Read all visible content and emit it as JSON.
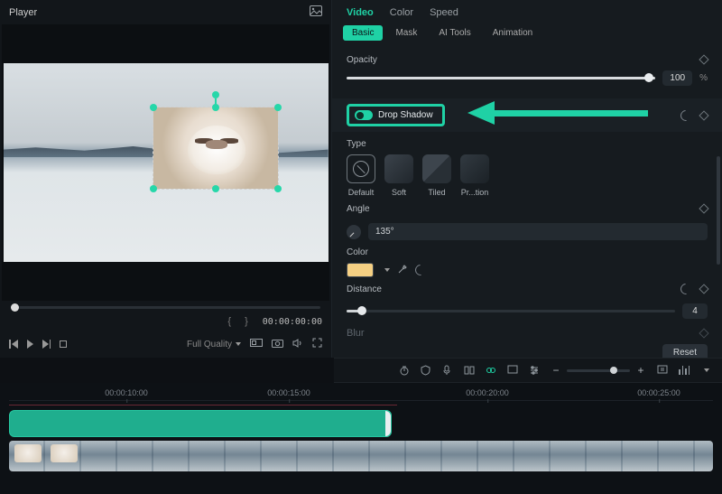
{
  "player": {
    "title": "Player",
    "braces": "{  }",
    "timecode": "00:00:00:00",
    "quality": "Full Quality"
  },
  "inspector": {
    "tabs1": [
      "Video",
      "Color",
      "Speed"
    ],
    "tabs1_active": 0,
    "tabs2": [
      "Basic",
      "Mask",
      "AI Tools",
      "Animation"
    ],
    "tabs2_active": 0,
    "opacity": {
      "label": "Opacity",
      "value": "100",
      "unit": "%"
    },
    "dropShadow": {
      "label": "Drop Shadow"
    },
    "type": {
      "label": "Type",
      "items": [
        "Default",
        "Soft",
        "Tiled",
        "Pr...tion"
      ]
    },
    "angle": {
      "label": "Angle",
      "value": "135°"
    },
    "color": {
      "label": "Color",
      "swatch": "#f5d083"
    },
    "distance": {
      "label": "Distance",
      "value": "4"
    },
    "blur": {
      "label": "Blur"
    },
    "reset": "Reset"
  },
  "timeline": {
    "ticks": [
      "00:00:10:00",
      "00:00:15:00",
      "00:00:20:00",
      "00:00:25:00"
    ]
  }
}
